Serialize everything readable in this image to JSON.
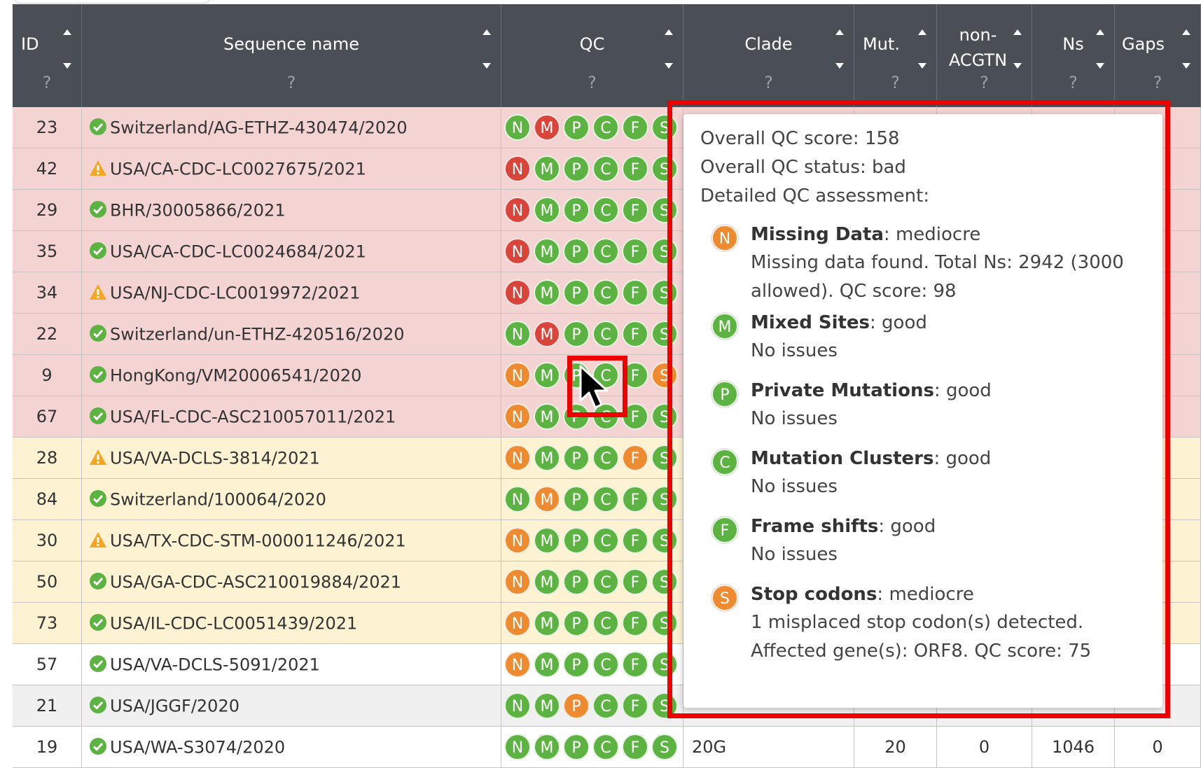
{
  "columns": [
    {
      "title": "ID",
      "help": "?"
    },
    {
      "title": "Sequence name",
      "help": "?"
    },
    {
      "title": "QC",
      "help": "?"
    },
    {
      "title": "Clade",
      "help": "?"
    },
    {
      "title": "Mut.",
      "help": "?"
    },
    {
      "title": "non-\nACGTN",
      "help": "?"
    },
    {
      "title": "Ns",
      "help": "?"
    },
    {
      "title": "Gaps",
      "help": "?"
    }
  ],
  "badge_letters": [
    "N",
    "M",
    "P",
    "C",
    "F",
    "S"
  ],
  "colors": {
    "good": "#5cb342",
    "mediocre": "#ee8a2f",
    "bad": "#d9453a",
    "row_bad": "#f4d3d3",
    "row_mediocre": "#fdf3d3",
    "row_good": "#ffffff",
    "row_good_alt": "#f0f0f0",
    "header_bg": "#4a4f55",
    "highlight": "#ee0000"
  },
  "rows": [
    {
      "id": "23",
      "name": "Switzerland/AG-ETHZ-430474/2020",
      "status": "ok",
      "tone": "bad",
      "qc": [
        "good",
        "bad",
        "good",
        "good",
        "good",
        "good"
      ]
    },
    {
      "id": "42",
      "name": "USA/CA-CDC-LC0027675/2021",
      "status": "warn",
      "tone": "bad",
      "qc": [
        "bad",
        "good",
        "good",
        "good",
        "good",
        "good"
      ]
    },
    {
      "id": "29",
      "name": "BHR/30005866/2021",
      "status": "ok",
      "tone": "bad",
      "qc": [
        "bad",
        "good",
        "good",
        "good",
        "good",
        "good"
      ]
    },
    {
      "id": "35",
      "name": "USA/CA-CDC-LC0024684/2021",
      "status": "ok",
      "tone": "bad",
      "qc": [
        "bad",
        "good",
        "good",
        "good",
        "good",
        "good"
      ]
    },
    {
      "id": "34",
      "name": "USA/NJ-CDC-LC0019972/2021",
      "status": "warn",
      "tone": "bad",
      "qc": [
        "bad",
        "good",
        "good",
        "good",
        "good",
        "good"
      ]
    },
    {
      "id": "22",
      "name": "Switzerland/un-ETHZ-420516/2020",
      "status": "ok",
      "tone": "bad",
      "qc": [
        "good",
        "bad",
        "good",
        "good",
        "good",
        "good"
      ]
    },
    {
      "id": "9",
      "name": "HongKong/VM20006541/2020",
      "status": "ok",
      "tone": "bad",
      "qc": [
        "mediocre",
        "good",
        "good",
        "good",
        "good",
        "mediocre"
      ]
    },
    {
      "id": "67",
      "name": "USA/FL-CDC-ASC210057011/2021",
      "status": "ok",
      "tone": "bad",
      "qc": [
        "mediocre",
        "good",
        "good",
        "good",
        "good",
        "good"
      ]
    },
    {
      "id": "28",
      "name": "USA/VA-DCLS-3814/2021",
      "status": "warn",
      "tone": "mediocre",
      "qc": [
        "mediocre",
        "good",
        "good",
        "good",
        "mediocre",
        "good"
      ]
    },
    {
      "id": "84",
      "name": "Switzerland/100064/2020",
      "status": "ok",
      "tone": "mediocre",
      "qc": [
        "good",
        "mediocre",
        "good",
        "good",
        "good",
        "good"
      ]
    },
    {
      "id": "30",
      "name": "USA/TX-CDC-STM-000011246/2021",
      "status": "warn",
      "tone": "mediocre",
      "qc": [
        "mediocre",
        "good",
        "good",
        "good",
        "good",
        "good"
      ]
    },
    {
      "id": "50",
      "name": "USA/GA-CDC-ASC210019884/2021",
      "status": "ok",
      "tone": "mediocre",
      "qc": [
        "mediocre",
        "good",
        "good",
        "good",
        "good",
        "good"
      ]
    },
    {
      "id": "73",
      "name": "USA/IL-CDC-LC0051439/2021",
      "status": "ok",
      "tone": "mediocre",
      "qc": [
        "mediocre",
        "good",
        "good",
        "good",
        "good",
        "good"
      ]
    },
    {
      "id": "57",
      "name": "USA/VA-DCLS-5091/2021",
      "status": "ok",
      "tone": "good",
      "qc": [
        "mediocre",
        "good",
        "good",
        "good",
        "good",
        "good"
      ]
    },
    {
      "id": "21",
      "name": "USA/JGGF/2020",
      "status": "ok",
      "tone": "good_alt",
      "qc": [
        "good",
        "good",
        "mediocre",
        "good",
        "good",
        "good"
      ]
    },
    {
      "id": "19",
      "name": "USA/WA-S3074/2020",
      "status": "ok",
      "tone": "good",
      "qc": [
        "good",
        "good",
        "good",
        "good",
        "good",
        "good"
      ],
      "clade": "20G",
      "mut": "20",
      "nonacgtn": "0",
      "ns": "1046",
      "gaps": "0"
    }
  ],
  "tooltip": {
    "score": "Overall QC score: 158",
    "status": "Overall QC status: bad",
    "detail_heading": "Detailed QC assessment:",
    "items": [
      {
        "letter": "N",
        "level": "mediocre",
        "name": "Missing Data",
        "value": ": mediocre",
        "desc": "Missing data found. Total Ns: 2942 (3000 allowed). QC score: 98"
      },
      {
        "letter": "M",
        "level": "good",
        "name": "Mixed Sites",
        "value": ": good",
        "desc": "No issues"
      },
      {
        "letter": "P",
        "level": "good",
        "name": "Private Mutations",
        "value": ": good",
        "desc": "No issues"
      },
      {
        "letter": "C",
        "level": "good",
        "name": "Mutation Clusters",
        "value": ": good",
        "desc": "No issues"
      },
      {
        "letter": "F",
        "level": "good",
        "name": "Frame shifts",
        "value": ": good",
        "desc": "No issues"
      },
      {
        "letter": "S",
        "level": "mediocre",
        "name": "Stop codons",
        "value": ": mediocre",
        "desc": "1 misplaced stop codon(s) detected. Affected gene(s): ORF8. QC score: 75"
      }
    ]
  }
}
